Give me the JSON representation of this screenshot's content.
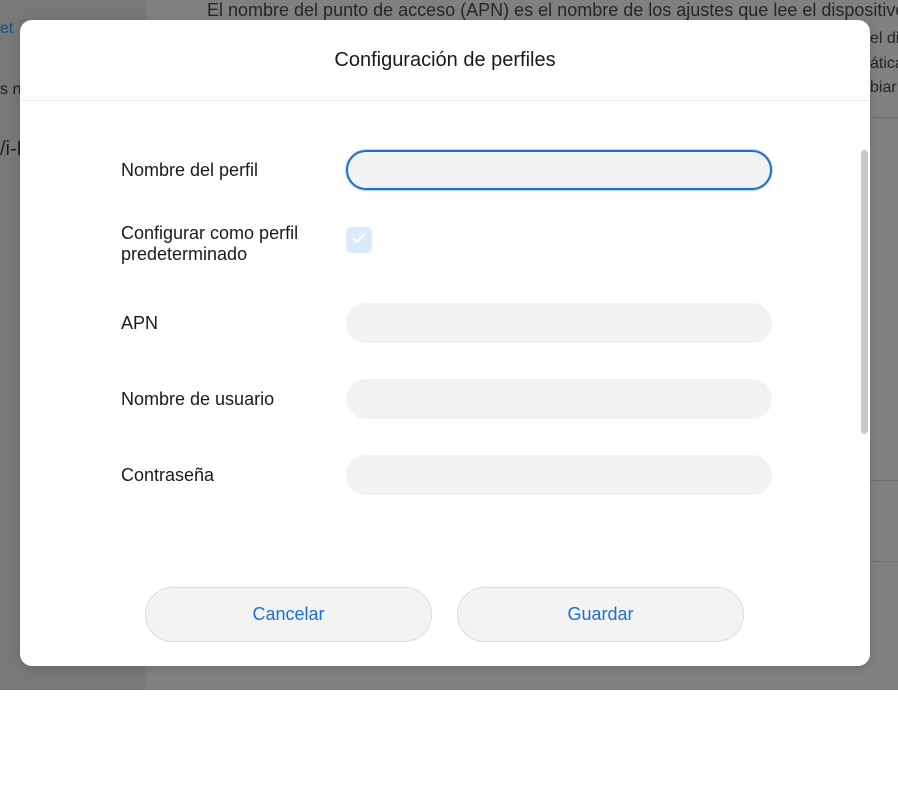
{
  "background": {
    "sidebar_link": "et",
    "sidebar_text_1": "s n",
    "sidebar_text_2": "/i-F",
    "paragraph_line": "El nombre del punto de acceso (APN) es el nombre de los ajustes que lee el dispositivo p",
    "right_fragments": [
      "el dis",
      "ática",
      "biar c"
    ]
  },
  "modal": {
    "title": "Configuración de perfiles",
    "fields": {
      "profile_name": {
        "label": "Nombre del perfil",
        "value": "",
        "placeholder": ""
      },
      "default_profile": {
        "label_line1": "Configurar como perfil",
        "label_line2": "predeterminado",
        "checked": true
      },
      "apn": {
        "label": "APN",
        "value": "",
        "placeholder": ""
      },
      "username": {
        "label": "Nombre de usuario",
        "value": "",
        "placeholder": ""
      },
      "password": {
        "label": "Contraseña",
        "value": "",
        "placeholder": ""
      }
    },
    "buttons": {
      "cancel": "Cancelar",
      "save": "Guardar"
    }
  },
  "colors": {
    "accent": "#1a6fd1",
    "checkbox_bg": "#d9ebfb",
    "field_bg": "#f2f2f2",
    "overlay": "#7e7e7e"
  },
  "icons": {
    "checkbox": "check-icon"
  }
}
